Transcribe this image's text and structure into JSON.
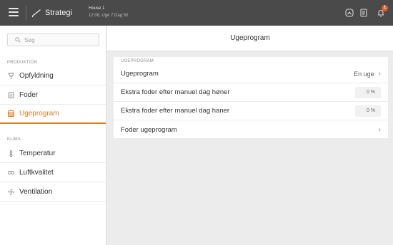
{
  "topbar": {
    "strategy_label": "Strategi",
    "house_name": "House 1",
    "house_date": "12:08, Uge 7 Dag 50",
    "alarm_count": "1"
  },
  "sidebar": {
    "search_placeholder": "Søg",
    "sections": [
      {
        "label": "PRODUKTION",
        "items": [
          {
            "label": "Opfyldning",
            "icon": "feeder-icon"
          },
          {
            "label": "Foder",
            "icon": "feed-icon"
          },
          {
            "label": "Ugeprogram",
            "icon": "week-program-icon",
            "active": true
          }
        ]
      },
      {
        "label": "KLIMA",
        "items": [
          {
            "label": "Temperatur",
            "icon": "thermometer-icon"
          },
          {
            "label": "Luftkvalitet",
            "icon": "co2-icon"
          },
          {
            "label": "Ventilation",
            "icon": "fan-icon"
          }
        ]
      }
    ]
  },
  "main": {
    "title": "Ugeprogram",
    "section_label": "UGEPROGRAM",
    "rows": [
      {
        "label": "Ugeprogram",
        "value": "En uge"
      },
      {
        "label": "Ekstra foder efter manuel dag høner",
        "value": "0 %"
      },
      {
        "label": "Ekstra foder efter manuel dag haner",
        "value": "0 %"
      },
      {
        "label": "Foder ugeprogram",
        "value": ""
      }
    ]
  },
  "colors": {
    "accent": "#e07b1e",
    "topbar": "#4a4a4a",
    "alarm": "#e85d2a"
  }
}
